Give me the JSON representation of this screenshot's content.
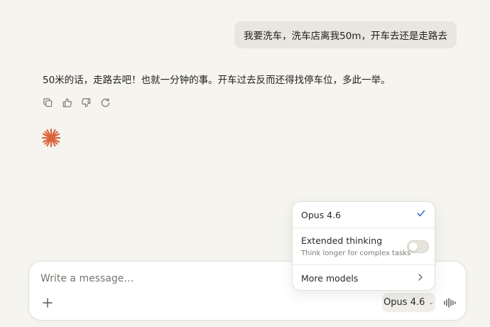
{
  "conversation": {
    "user_message": "我要洗车，洗车店离我50m，开车去还是走路去",
    "assistant_message": "50米的话，走路去吧！也就一分钟的事。开车过去反而还得找停车位，多此一举。",
    "actions": [
      "copy-icon",
      "thumbs-up-icon",
      "thumbs-down-icon",
      "retry-icon"
    ],
    "spark_icon": "claude-spark-icon"
  },
  "composer": {
    "placeholder": "Write a message…",
    "model_label": "Opus 4.6"
  },
  "model_menu": {
    "current_model": "Opus 4.6",
    "current_selected": true,
    "extended_thinking_label": "Extended thinking",
    "extended_thinking_desc": "Think longer for complex tasks",
    "extended_thinking_on": false,
    "more_models_label": "More models"
  },
  "colors": {
    "background": "#f5f4ef",
    "accent_spark": "#d9643c",
    "check": "#2f6fd6"
  }
}
